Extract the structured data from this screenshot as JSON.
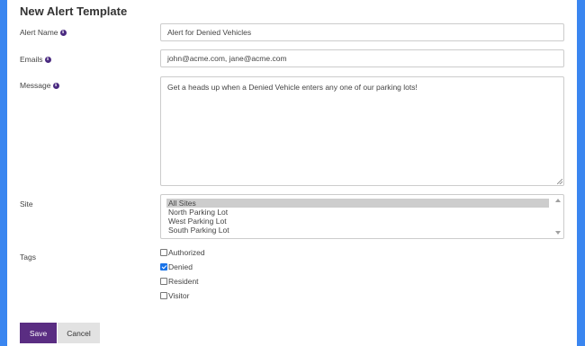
{
  "form": {
    "title": "New Alert Template",
    "alert_name": {
      "label": "Alert Name",
      "value": "Alert for Denied Vehicles"
    },
    "emails": {
      "label": "Emails",
      "value": "john@acme.com, jane@acme.com"
    },
    "message": {
      "label": "Message",
      "value": "Get a heads up when a Denied Vehicle enters any one of our parking lots!"
    },
    "site": {
      "label": "Site",
      "options": [
        "All Sites",
        "North Parking Lot",
        "West Parking Lot",
        "South Parking Lot"
      ],
      "selected": "All Sites"
    },
    "tags": {
      "label": "Tags",
      "items": [
        {
          "label": "Authorized",
          "checked": false
        },
        {
          "label": "Denied",
          "checked": true
        },
        {
          "label": "Resident",
          "checked": false
        },
        {
          "label": "Visitor",
          "checked": false
        }
      ]
    },
    "save_label": "Save",
    "cancel_label": "Cancel",
    "info_icon_glyph": "i"
  },
  "colors": {
    "background": "#3a86f0",
    "primary_button": "#5a2d82",
    "secondary_button": "#e2e2e2",
    "info_icon": "#4a2a80",
    "checkbox_checked": "#1a73e8"
  }
}
